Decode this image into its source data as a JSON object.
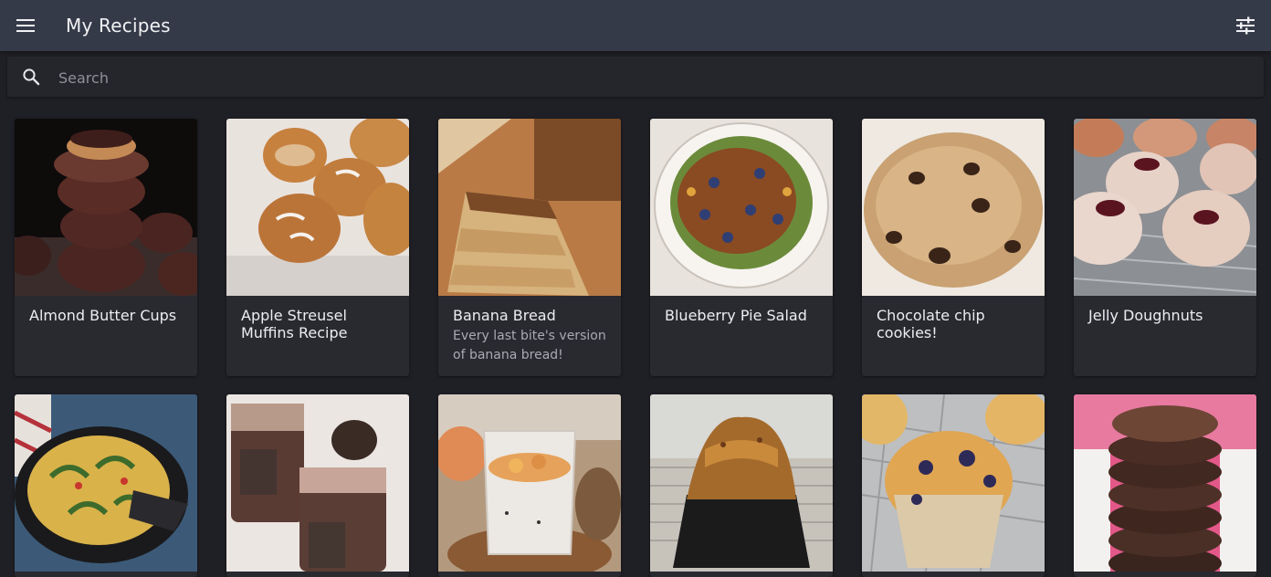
{
  "appbar": {
    "title": "My Recipes",
    "menu_icon": "hamburger-menu-icon",
    "filter_icon": "sliders-icon"
  },
  "search": {
    "placeholder": "Search",
    "value": ""
  },
  "recipes": [
    {
      "title": "Almond Butter Cups",
      "description": ""
    },
    {
      "title": "Apple Streusel Muffins Recipe",
      "description": ""
    },
    {
      "title": "Banana Bread",
      "description": "Every last bite's version of banana bread!"
    },
    {
      "title": "Blueberry Pie Salad",
      "description": ""
    },
    {
      "title": "Chocolate chip cookies!",
      "description": ""
    },
    {
      "title": "Jelly Doughnuts",
      "description": ""
    },
    {
      "title": "",
      "description": ""
    },
    {
      "title": "",
      "description": ""
    },
    {
      "title": "",
      "description": ""
    },
    {
      "title": "",
      "description": ""
    },
    {
      "title": "",
      "description": ""
    },
    {
      "title": "",
      "description": ""
    }
  ]
}
